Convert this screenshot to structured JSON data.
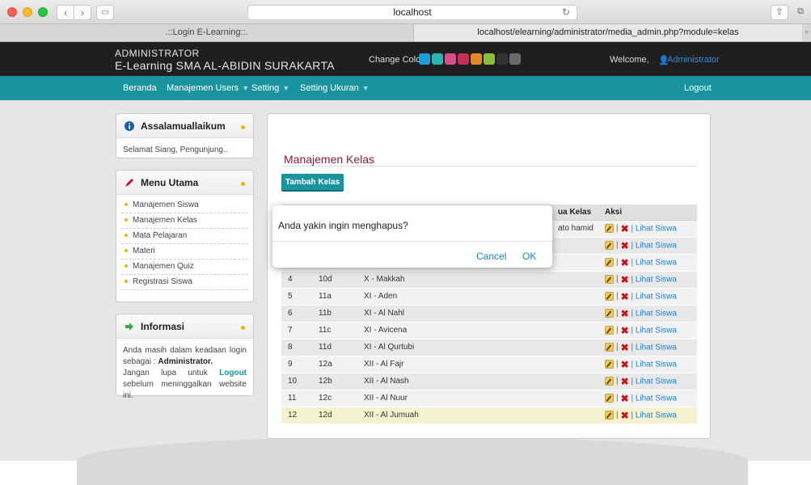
{
  "browser": {
    "address": "localhost",
    "tabs": [
      ".::Login E-Learning::.",
      "localhost/elearning/administrator/media_admin.php?module=kelas"
    ]
  },
  "header": {
    "brand_line1": "ADMINISTRATOR",
    "brand_line2": "E-Learning SMA AL-ABIDIN SURAKARTA",
    "change_color": "Change Color",
    "swatches": [
      "#1f9fd5",
      "#2bb3b3",
      "#d94d8a",
      "#c72f55",
      "#e08a2a",
      "#8bbf3a",
      "#333333",
      "#6a6a6a"
    ],
    "welcome": "Welcome,",
    "user": "Administrator"
  },
  "menu": {
    "beranda": "Beranda",
    "users": "Manajemen Users",
    "setting": "Setting",
    "ukuran": "Setting Ukuran",
    "logout": "Logout"
  },
  "sidebar": {
    "greeting_title": "Assalamuallaikum",
    "greeting_text": "Selamat Siang, Pengunjung..",
    "menu_title": "Menu Utama",
    "menu_items": [
      "Manajemen Siswa",
      "Manajemen Kelas",
      "Mata Pelajaran",
      "Materi",
      "Manajemen Quiz",
      "Registrasi Siswa"
    ],
    "info_title": "Informasi",
    "info_1": "Anda masih dalam keadaan login sebagai :",
    "info_user": "Administrator.",
    "info_2": "Jangan lupa untuk",
    "info_logout": "Logout",
    "info_3": "sebelum meninggalkan website ini."
  },
  "main": {
    "title": "Manajemen Kelas",
    "add_button": "Tambah Kelas",
    "col_wali": "ua Kelas",
    "col_aksi": "Aksi",
    "lihat": "| Lihat Siswa",
    "row1_wali": "ato hamid",
    "rows": [
      {
        "no": "4",
        "kode": "10d",
        "nama": "X - Makkah"
      },
      {
        "no": "5",
        "kode": "11a",
        "nama": "XI - Aden"
      },
      {
        "no": "6",
        "kode": "11b",
        "nama": "XI - Al Nahl"
      },
      {
        "no": "7",
        "kode": "11c",
        "nama": "XI - Avicena"
      },
      {
        "no": "8",
        "kode": "11d",
        "nama": "XI - Al Qurtubi"
      },
      {
        "no": "9",
        "kode": "12a",
        "nama": "XII - Al Fajr"
      },
      {
        "no": "10",
        "kode": "12b",
        "nama": "XII - Al Nash"
      },
      {
        "no": "11",
        "kode": "12c",
        "nama": "XII - Al Nuur"
      },
      {
        "no": "12",
        "kode": "12d",
        "nama": "XII - Al Jumuah"
      }
    ]
  },
  "dialog": {
    "message": "Anda yakin ingin menghapus?",
    "cancel": "Cancel",
    "ok": "OK"
  }
}
